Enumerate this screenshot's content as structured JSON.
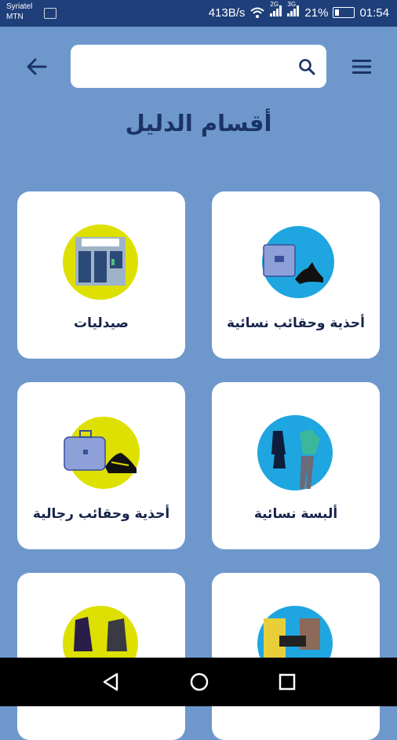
{
  "status_bar": {
    "carrier_1": "Syriatel",
    "carrier_2": "MTN",
    "speed": "413B/s",
    "net_1": "2G",
    "net_2": "3G",
    "battery": "21%",
    "time": "01:54"
  },
  "header": {
    "search_placeholder": "",
    "back_icon": "arrow-left-icon",
    "menu_icon": "hamburger-icon",
    "search_icon": "magnifier-icon"
  },
  "title": "أقسام الدليل",
  "categories": [
    {
      "label": "أحذية وحقائب نسائية",
      "icon": "womens-shoes-bags",
      "circle": "#1fa6e0"
    },
    {
      "label": "صيدليات",
      "icon": "pharmacy",
      "circle": "#dde000"
    },
    {
      "label": "ألبسة نسائية",
      "icon": "womens-clothing",
      "circle": "#1fa6e0"
    },
    {
      "label": "أحذية وحقائب رجالية",
      "icon": "mens-shoes-bags",
      "circle": "#dde000"
    },
    {
      "label": "",
      "icon": "food-drinks",
      "circle": "#1fa6e0"
    },
    {
      "label": "",
      "icon": "clothing",
      "circle": "#dde000"
    }
  ],
  "colors": {
    "background": "#6e98cc",
    "status_bar": "#1f3f7a",
    "title": "#1c3366"
  }
}
